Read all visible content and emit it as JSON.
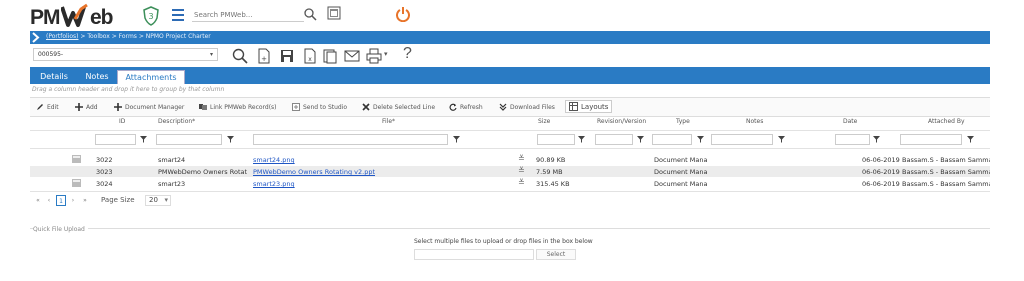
{
  "app": {
    "logo_pm": "PM",
    "logo_web": "eb",
    "shield_number": "3",
    "search_placeholder": "Search PMWeb..."
  },
  "breadcrumb": {
    "root": "(Portfolios)",
    "rest": " > Toolbox > Forms > NPMO Project Charter"
  },
  "record": {
    "selected": "000595-"
  },
  "toolbar": {
    "help_label": "?"
  },
  "tabs": [
    "Details",
    "Notes",
    "Attachments"
  ],
  "active_tab": "Attachments",
  "grid_hint": "Drag a column header and drop it here to group by that column",
  "grid_toolbar": {
    "edit": "Edit",
    "add": "Add",
    "document_manager": "Document Manager",
    "link_records": "Link PMWeb Record(s)",
    "send_to_studio": "Send to Studio",
    "delete_selected": "Delete Selected Line",
    "refresh": "Refresh",
    "download_files": "Download Files",
    "layouts": "Layouts"
  },
  "columns": {
    "id": "ID",
    "description": "Description*",
    "file": "File*",
    "size": "Size",
    "revision": "Revision/Version",
    "type": "Type",
    "notes": "Notes",
    "date": "Date",
    "attached_by": "Attached By"
  },
  "rows": [
    {
      "id": "3022",
      "description": "smart24",
      "file": "smart24.png",
      "size": "90.89 KB",
      "revision": "",
      "type": "Document Mana",
      "notes": "",
      "date": "06-06-2019",
      "attached_by": "Bassam.S - Bassam Samman"
    },
    {
      "id": "3023",
      "description": "PMWebDemo Owners Rotat",
      "file": "PMWebDemo Owners Rotating v2.ppt",
      "size": "7.59 MB",
      "revision": "",
      "type": "Document Mana",
      "notes": "",
      "date": "06-06-2019",
      "attached_by": "Bassam.S - Bassam Samman"
    },
    {
      "id": "3024",
      "description": "smart23",
      "file": "smart23.png",
      "size": "315.45 KB",
      "revision": "",
      "type": "Document Mana",
      "notes": "",
      "date": "06-06-2019",
      "attached_by": "Bassam.S - Bassam Samman"
    }
  ],
  "pager": {
    "first": "«",
    "prev": "‹",
    "current": "1",
    "next": "›",
    "last": "»",
    "page_size_label": "Page Size",
    "page_size": "20"
  },
  "quick_upload": {
    "label": "Quick File Upload",
    "instructions": "Select multiple files to upload or drop files in the box below",
    "select_button": "Select"
  },
  "colors": {
    "brand_blue": "#2a7bc4",
    "power_orange": "#e8742a",
    "shield_green": "#3c8f5a",
    "link_blue": "#1f56c5"
  }
}
